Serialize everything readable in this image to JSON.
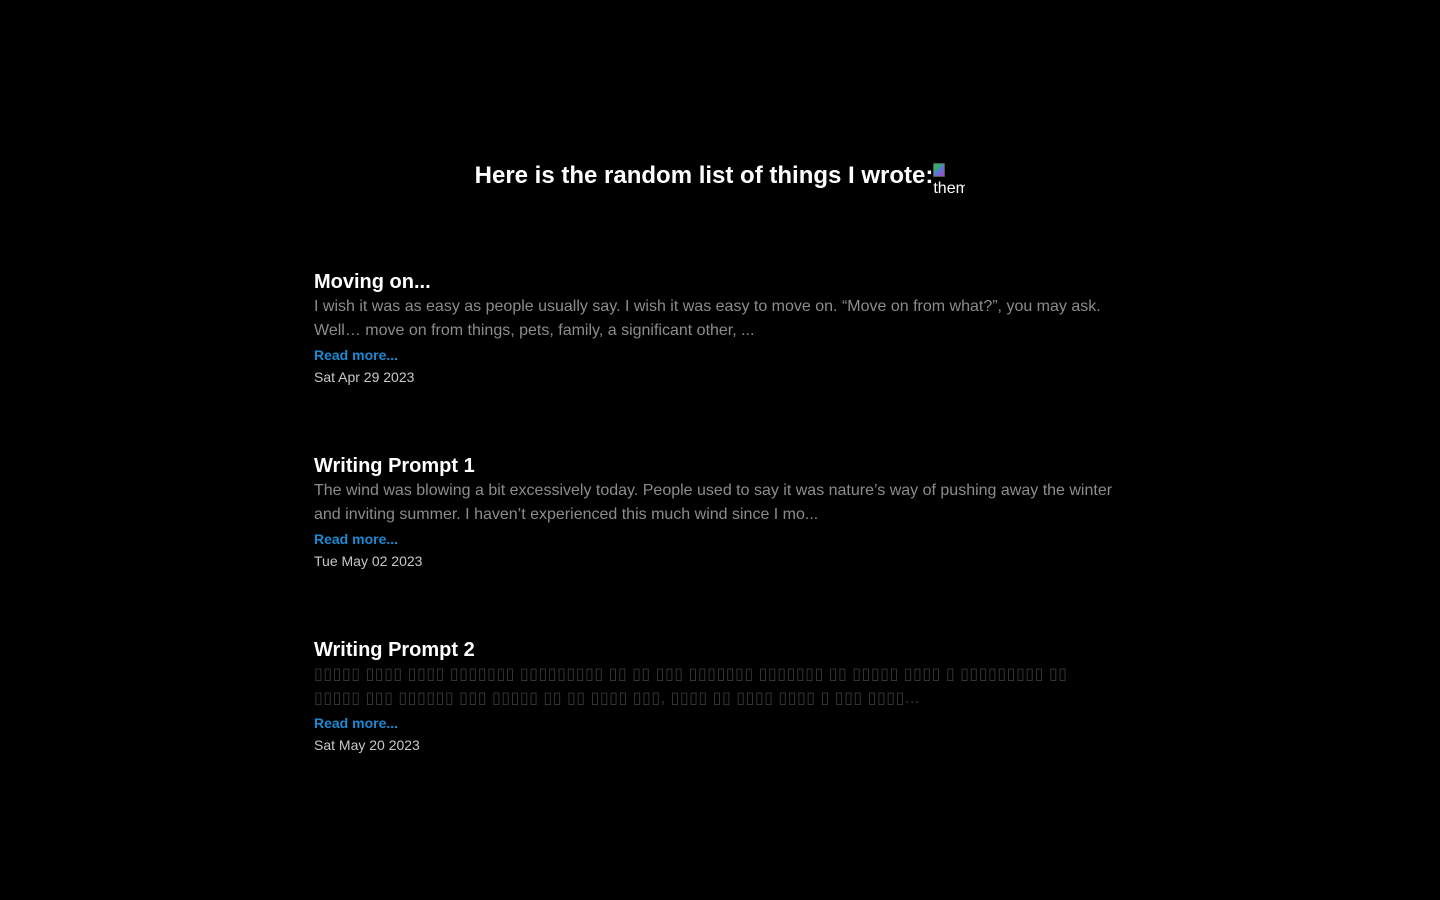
{
  "header": {
    "title": "Here is the random list of things I wrote:",
    "theme_toggle_alt": "theme-toggle"
  },
  "posts": [
    {
      "title": "Moving on...",
      "excerpt": "I wish it was as easy as people usually say. I wish it was easy to move on. “Move on from what?”, you may ask. Well… move on from things, pets, family, a significant other, ...",
      "read_more": "Read more...",
      "date": "Sat Apr 29 2023"
    },
    {
      "title": "Writing Prompt 1",
      "excerpt": "The wind was blowing a bit excessively today. People used to say it was nature’s way of pushing away the winter and inviting summer. I haven’t experienced this much wind since I mo...",
      "read_more": "Read more...",
      "date": "Tue May 02 2023"
    },
    {
      "title": "Writing Prompt 2",
      "excerpt": "▯▯▯▯▯ ▯▯▯▯ ▯▯▯▯ ▯▯▯▯▯▯▯ ▯▯▯▯▯▯▯▯▯ ▯▯ ▯▯ ▯▯▯ ▯▯▯▯▯▯▯ ▯▯▯▯▯▯▯ ▯▯ ▯▯▯▯▯ ▯▯▯▯ ▯ ▯▯▯▯▯▯▯▯▯ ▯▯ ▯▯▯▯▯ ▯▯▯ ▯▯▯▯▯▯ ▯▯▯ ▯▯▯▯▯ ▯▯ ▯▯ ▯▯▯▯ ▯▯▯, ▯▯▯▯ ▯▯ ▯▯▯▯ ▯▯▯▯ ▯ ▯▯▯ ▯▯▯▯...",
      "read_more": "Read more...",
      "date": "Sat May 20 2023"
    }
  ],
  "colors": {
    "background": "#000000",
    "title": "#ffffff",
    "excerpt": "#8c8c8c",
    "link": "#1e88d0",
    "date": "#c8c8c8"
  }
}
